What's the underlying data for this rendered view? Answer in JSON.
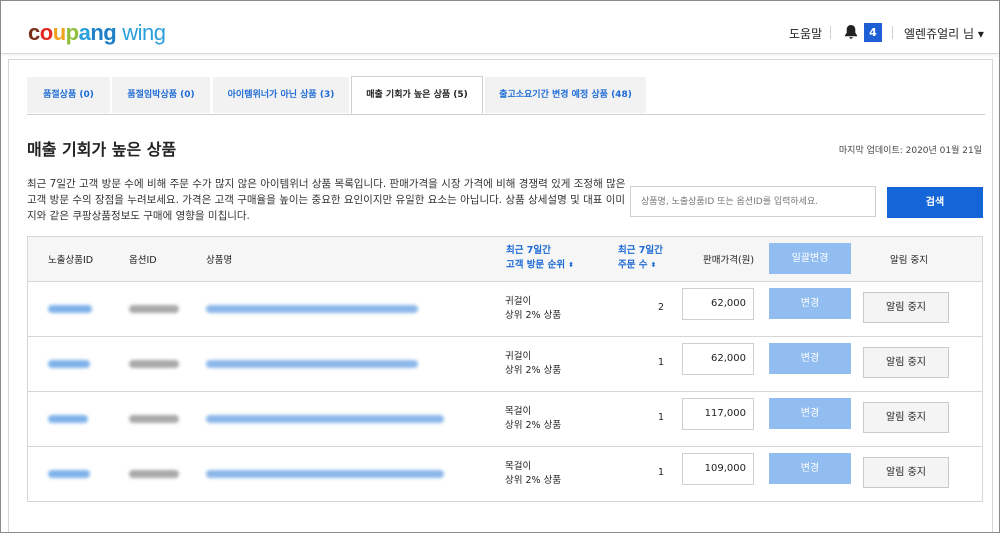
{
  "header": {
    "logo": {
      "c": "c",
      "o": "o",
      "u": "u",
      "p": "p",
      "a": "a",
      "ng": "ng",
      "wing": "wing"
    },
    "help": "도움말",
    "notification_count": "4",
    "user": "엘렌쥬얼리 님 ▾"
  },
  "tabs": [
    {
      "label": "품절상품 (0)"
    },
    {
      "label": "품절임박상품 (0)"
    },
    {
      "label": "아이템위너가 아닌 상품 (3)"
    },
    {
      "label": "매출 기회가 높은 상품 (5)"
    },
    {
      "label": "출고소요기간 변경 예정 상품 (48)"
    }
  ],
  "page": {
    "title": "매출 기회가 높은 상품",
    "updated": "마지막 업데이트: 2020년 01월 21일",
    "description": "최근 7일간 고객 방문 수에 비해 주문 수가 많지 않은 아이템위너 상품 목록입니다. 판매가격을 시장 가격에 비해 경쟁력 있게 조정해 많은 고객 방문 수의 장점을 누려보세요. 가격은 고객 구매율을 높이는 중요한 요인이지만 유일한 요소는 아닙니다. 상품 상세설명 및 대표 이미지와 같은 쿠팡상품정보도 구매에 영향을 미칩니다."
  },
  "search": {
    "placeholder": "상품명, 노출상품ID 또는 옵션ID를 입력하세요.",
    "button": "검색"
  },
  "table": {
    "headers": {
      "exposed_id": "노출상품ID",
      "option_id": "옵션ID",
      "product_name": "상품명",
      "visit_rank_1": "최근 7일간",
      "visit_rank_2": "고객 방문 순위",
      "orders_1": "최근 7일간",
      "orders_2": "주문 수",
      "price": "판매가격(원)",
      "bulk_change": "일괄변경",
      "stop_alert": "알림 중지"
    },
    "sort_icon": "⬍",
    "rows": [
      {
        "rank_1": "귀걸이",
        "rank_2": "상위 2% 상품",
        "orders": "2",
        "price": "62,000",
        "change": "변경",
        "stop": "알림 중지"
      },
      {
        "rank_1": "귀걸이",
        "rank_2": "상위 2% 상품",
        "orders": "1",
        "price": "62,000",
        "change": "변경",
        "stop": "알림 중지"
      },
      {
        "rank_1": "목걸이",
        "rank_2": "상위 2% 상품",
        "orders": "1",
        "price": "117,000",
        "change": "변경",
        "stop": "알림 중지"
      },
      {
        "rank_1": "목걸이",
        "rank_2": "상위 2% 상품",
        "orders": "1",
        "price": "109,000",
        "change": "변경",
        "stop": "알림 중지"
      }
    ]
  },
  "colors": {
    "accent_blue": "#1466d8",
    "link_blue": "#1e6bd6",
    "light_button": "#92bdf0",
    "badge": "#1f5fd6"
  }
}
